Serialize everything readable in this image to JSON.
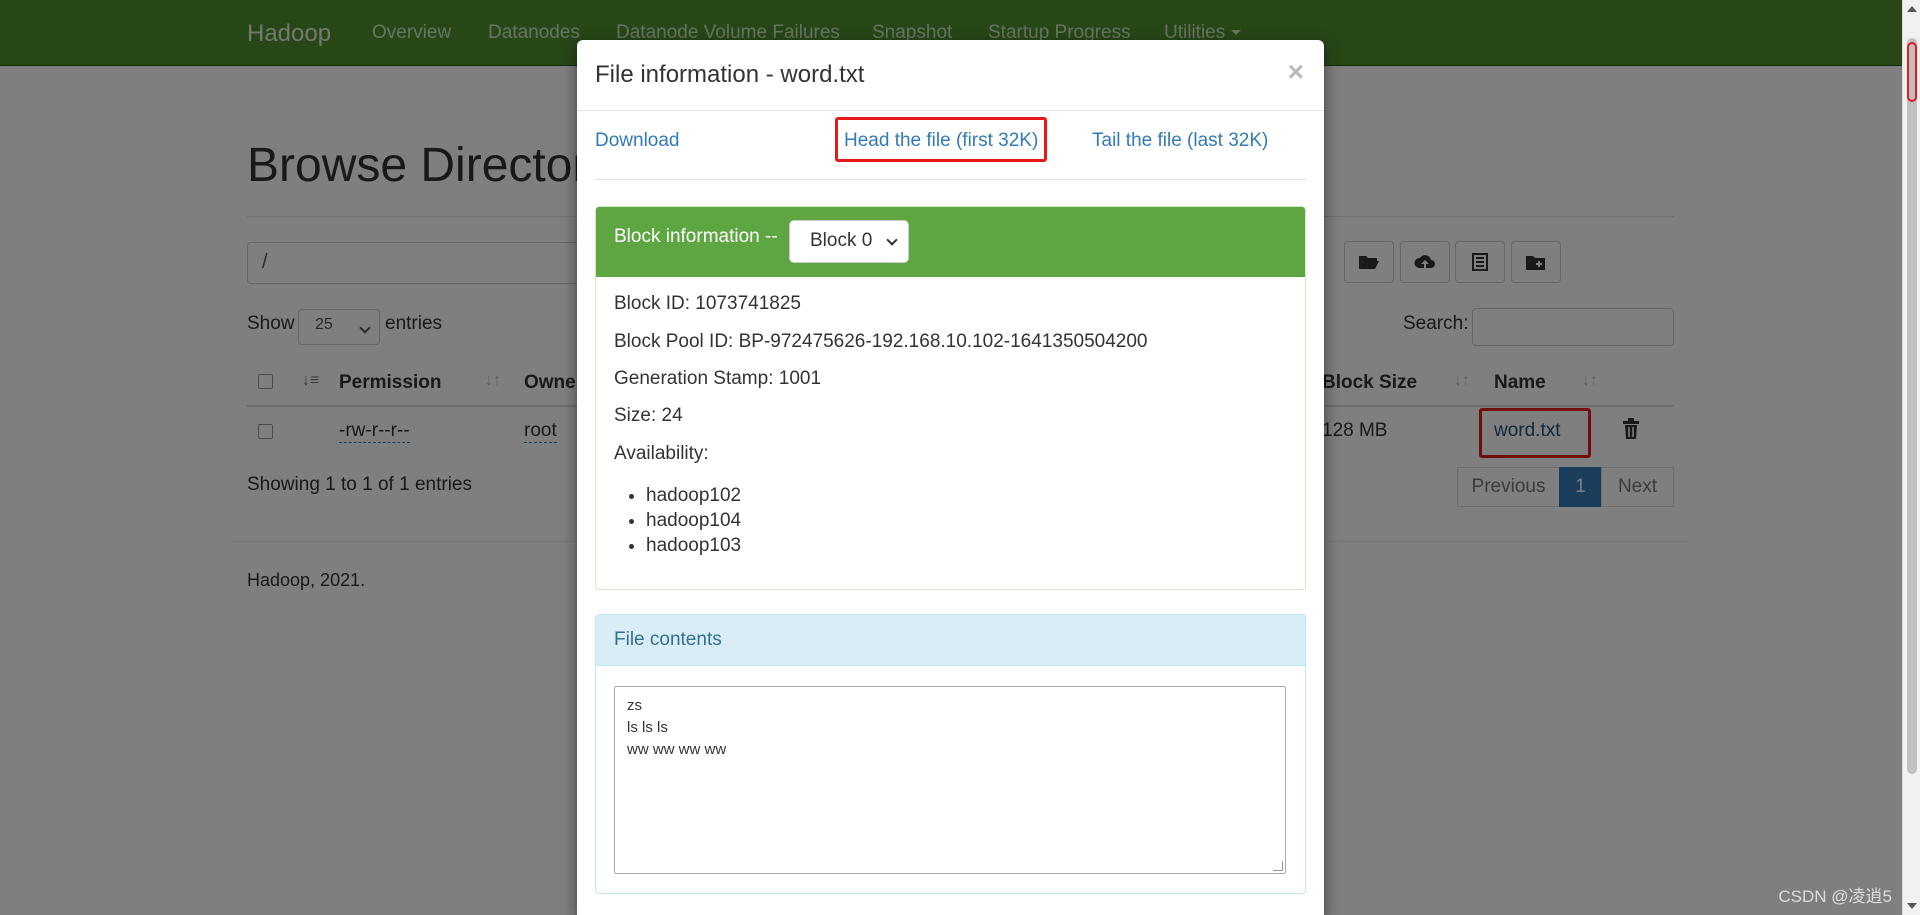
{
  "navbar": {
    "brand": "Hadoop",
    "links": [
      "Overview",
      "Datanodes",
      "Datanode Volume Failures",
      "Snapshot",
      "Startup Progress",
      "Utilities"
    ]
  },
  "page": {
    "title": "Browse Directory",
    "path": "/",
    "show_label": "Show",
    "entries_value": "25",
    "entries_label": "entries",
    "search_label": "Search:",
    "columns": {
      "permission": "Permission",
      "owner": "Owner",
      "block_size": "Block Size",
      "name": "Name"
    },
    "row": {
      "permission": "-rw-r--r--",
      "owner": "root",
      "block_size": "128 MB",
      "name": "word.txt"
    },
    "showing": "Showing 1 to 1 of 1 entries",
    "pagination": {
      "previous": "Previous",
      "current": "1",
      "next": "Next"
    },
    "footer": "Hadoop, 2021."
  },
  "modal": {
    "title": "File information - word.txt",
    "close": "×",
    "links": {
      "download": "Download",
      "head": "Head the file (first 32K)",
      "tail": "Tail the file (last 32K)"
    },
    "block_panel": {
      "label": "Block information --",
      "selected_block": "Block 0",
      "block_id": "Block ID: 1073741825",
      "pool_id": "Block Pool ID: BP-972475626-192.168.10.102-1641350504200",
      "generation": "Generation Stamp: 1001",
      "size": "Size: 24",
      "availability_label": "Availability:",
      "hosts": [
        "hadoop102",
        "hadoop104",
        "hadoop103"
      ]
    },
    "contents_panel": {
      "label": "File contents",
      "text": "zs\nls ls ls\nww ww ww ww"
    }
  },
  "watermark": "CSDN @凌逍5",
  "colors": {
    "navbar": "#4f8f2f",
    "block_header": "#5ea641",
    "link": "#337ab7",
    "highlight": "#e41a1a"
  }
}
